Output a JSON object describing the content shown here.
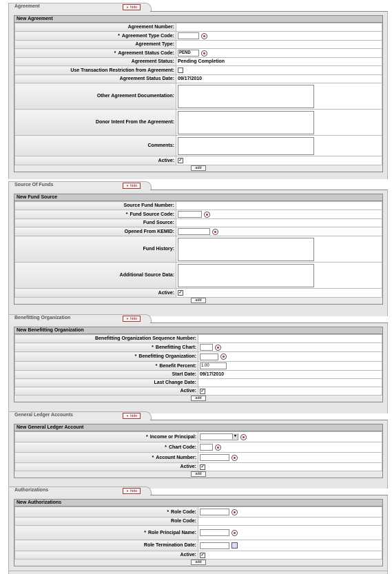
{
  "hide_label": "hide",
  "add_label": "add",
  "agreement": {
    "tab_title": "Agreement",
    "subhead": "New Agreement",
    "number_label": "Agreement Number:",
    "type_code_label": "Agreement Type Code:",
    "type_label": "Agreement Type:",
    "status_code_label": "Agreement Status Code:",
    "status_code_value": "PEND",
    "status_label": "Agreement Status:",
    "status_value": "Pending Completion",
    "restriction_label": "Use Transaction Restriction from Agreement:",
    "status_date_label": "Agreement Status Date:",
    "status_date_value": "09/17/2010",
    "other_doc_label": "Other Agreement Documentation:",
    "donor_intent_label": "Donor Intent From the Agreement:",
    "comments_label": "Comments:",
    "active_label": "Active:"
  },
  "source_of_funds": {
    "tab_title": "Source Of Funds",
    "subhead": "New Fund Source",
    "source_fund_number_label": "Source Fund Number:",
    "fund_source_code_label": "Fund Source Code:",
    "fund_source_label": "Fund Source:",
    "opened_from_kemid_label": "Opened From KEMID:",
    "fund_history_label": "Fund History:",
    "additional_source_label": "Additional Source Data:",
    "active_label": "Active:"
  },
  "benefitting_org": {
    "tab_title": "Benefitting Organization",
    "subhead": "New Benefitting Organization",
    "seq_label": "Benefitting Organization Sequence Number:",
    "chart_label": "Benefitting Chart:",
    "org_label": "Benefitting Organization:",
    "percent_label": "Benefit Percent:",
    "percent_value": "1.00",
    "start_date_label": "Start Date:",
    "start_date_value": "09/17/2010",
    "last_change_label": "Last Change Date:",
    "active_label": "Active:"
  },
  "gl_accounts": {
    "tab_title": "General Ledger Accounts",
    "subhead": "New General Ledger Account",
    "income_label": "Income or Principal:",
    "chart_label": "Chart Code:",
    "account_label": "Account Number:",
    "active_label": "Active:"
  },
  "authorizations": {
    "tab_title": "Authorizations",
    "subhead": "New Authorizations",
    "role_code_label": "Role Code:",
    "role_code_ro_label": "Role Code:",
    "principal_label": "Role Principal Name:",
    "termination_label": "Role Termination Date:",
    "active_label": "Active:"
  },
  "required_marker": "*",
  "checkmark": "✓"
}
